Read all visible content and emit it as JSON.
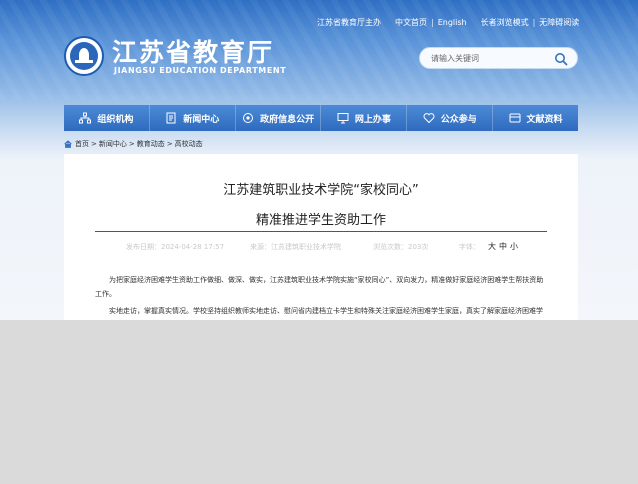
{
  "top_links": {
    "sponsor": "江苏省教育厅主办",
    "chinese_home": "中文首页",
    "english": "English",
    "elder_mode": "长者浏览模式",
    "accessible": "无障碍阅读",
    "separator": "|"
  },
  "header": {
    "title": "江苏省教育厅",
    "subtitle": "JIANGSU EDUCATION DEPARTMENT"
  },
  "search": {
    "placeholder": "请输入关键词"
  },
  "nav": {
    "items": [
      {
        "label": "组织机构",
        "icon": "org-icon"
      },
      {
        "label": "新闻中心",
        "icon": "news-icon"
      },
      {
        "label": "政府信息公开",
        "icon": "disclosure-icon"
      },
      {
        "label": "网上办事",
        "icon": "online-service-icon"
      },
      {
        "label": "公众参与",
        "icon": "heart-icon"
      },
      {
        "label": "文献资料",
        "icon": "documents-icon"
      }
    ]
  },
  "breadcrumb": {
    "items": [
      "首页",
      "新闻中心",
      "教育动态",
      "高校动态"
    ],
    "arrow": ">"
  },
  "article": {
    "title_line1": "江苏建筑职业技术学院“家校同心”",
    "title_line2": "精准推进学生资助工作",
    "publish_date": "发布日期：2024-04-28 17:57",
    "source": "来源：江苏建筑职业技术学院",
    "views": "浏览次数：203次",
    "font_size_label": "字体：",
    "font_size_options": [
      "大",
      "中",
      "小"
    ],
    "paragraph1": "为把家庭经济困难学生资助工作做细、做深、做实，江苏建筑职业技术学院实施“家校同心”、双向发力，精准做好家庭经济困难学生帮扶资助工作。",
    "paragraph2": "实地走访，掌握真实情况。学校坚持组织教师实地走访、慰问省内建档立卡学生和特殊关注家庭经济困难学生家庭，真实了解家庭经济困难学生生活状况，帮扶"
  },
  "colors": {
    "nav_bg": "#2e6bbf",
    "header_top": "#2f6fc4",
    "overlay_gray": "#dadada"
  }
}
